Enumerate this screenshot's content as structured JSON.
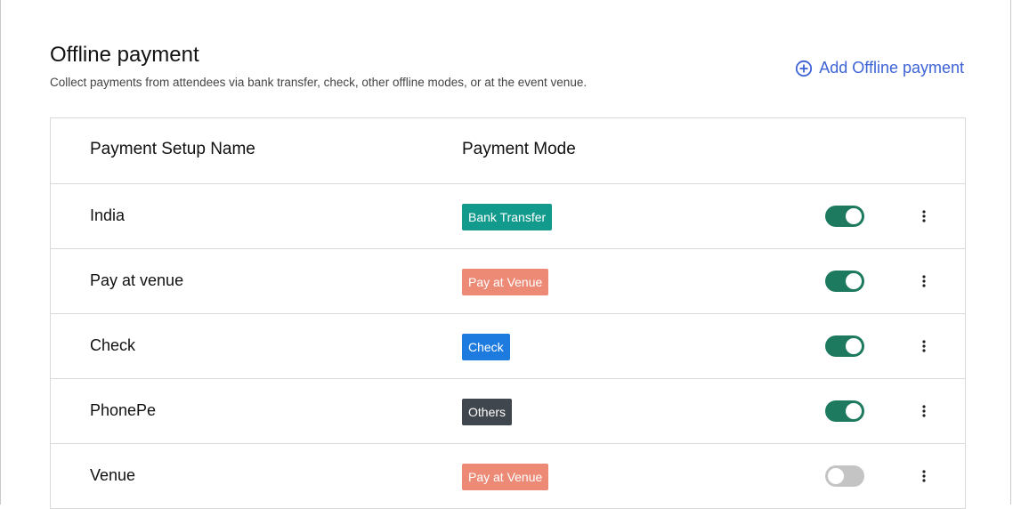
{
  "header": {
    "title": "Offline payment",
    "subtitle": "Collect payments from attendees via bank transfer, check, other offline modes, or at the event venue.",
    "add_label": "Add Offline payment",
    "add_icon": "plus-circle-icon",
    "accent_color": "#3d63d6"
  },
  "table": {
    "columns": [
      "Payment Setup Name",
      "Payment Mode"
    ],
    "rows": [
      {
        "name": "India",
        "mode": "Bank Transfer",
        "mode_color": "#129a8d",
        "enabled": true
      },
      {
        "name": "Pay at venue",
        "mode": "Pay at Venue",
        "mode_color": "#ec8a76",
        "enabled": true
      },
      {
        "name": "Check",
        "mode": "Check",
        "mode_color": "#1d7be0",
        "enabled": true
      },
      {
        "name": "PhonePe",
        "mode": "Others",
        "mode_color": "#40464d",
        "enabled": true
      },
      {
        "name": "Venue",
        "mode": "Pay at Venue",
        "mode_color": "#ec8a76",
        "enabled": false
      }
    ],
    "toggle_on_color": "#1e7a5e",
    "toggle_off_color": "#c4c4c4",
    "row_menu_icon": "more-vertical-icon"
  }
}
